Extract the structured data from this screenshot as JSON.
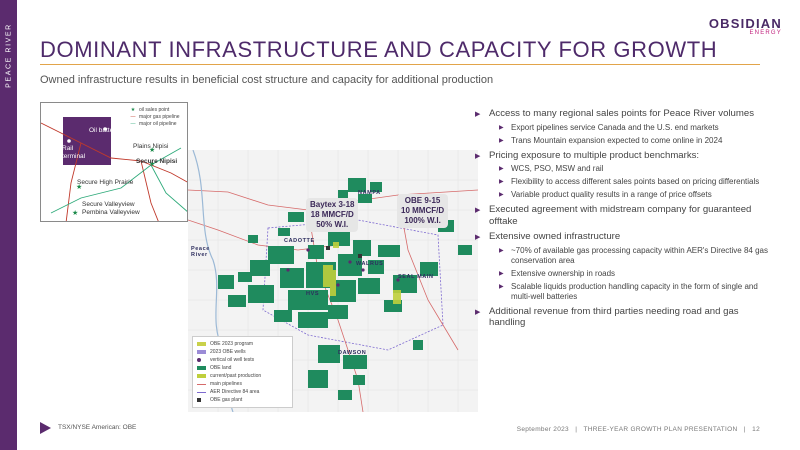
{
  "sidebar": {
    "label": "PEACE RIVER"
  },
  "logo": {
    "main": "OBSIDIAN",
    "sub": "ENERGY"
  },
  "header": {
    "title": "DOMINANT INFRASTRUCTURE AND CAPACITY FOR GROWTH",
    "subtitle": "Owned infrastructure results in beneficial cost structure and capacity for additional production"
  },
  "inset_map": {
    "labels": {
      "oil_battery": "Oil battery",
      "rail_terminal": "Rail\nterminal",
      "plains_nipisi": "Plains Nipisi",
      "secure_nipisi": "Secure Nipisi",
      "secure_high_prairie": "Secure High Prairie",
      "secure_valleyview": "Secure Valleyview",
      "pembina_valleyview": "Pembina Valleyview"
    },
    "legend": [
      {
        "marker": "★",
        "label": "oil sales point",
        "color": "#1b8a4a"
      },
      {
        "marker": "—",
        "label": "major gas pipeline",
        "color": "#c0392b"
      },
      {
        "marker": "—",
        "label": "major oil pipeline",
        "color": "#2eaa7a"
      }
    ]
  },
  "main_map": {
    "callouts": [
      {
        "text": "Baytex 3-18\n18 MMCF/D\n50% W.I."
      },
      {
        "text": "OBE 9-15\n10 MMCF/D\n100% W.I."
      }
    ],
    "towns": {
      "nampa": "NAMPA",
      "peace_river": "Peace\nRiver",
      "cadotte": "CADOTTE",
      "walrus": "WALRUS",
      "seal_main": "SEAL MAIN",
      "hvs": "HVS",
      "dawson": "DAWSON"
    },
    "legend": [
      {
        "label": "OBE 2023 program",
        "color": "#c9d14a"
      },
      {
        "label": "2023 OBE wells",
        "color": "#9b8bd6"
      },
      {
        "label": "vertical oil well tests",
        "color": "#5b2b6e"
      },
      {
        "label": "OBE land",
        "color": "#1f8b5e"
      },
      {
        "label": "current/past production",
        "color": "#bfcf3c"
      },
      {
        "label": "main pipelines",
        "color": "#d66a6a"
      },
      {
        "label": "AER Directive 84 area",
        "color": "#7e6ad0"
      },
      {
        "label": "OBE gas plant",
        "color": "#333333"
      }
    ]
  },
  "bullets": [
    {
      "text": "Access to many regional sales points for Peace River volumes",
      "sub": [
        "Export pipelines service Canada and the U.S. end markets",
        "Trans Mountain expansion expected to come online in 2024"
      ]
    },
    {
      "text": "Pricing exposure to multiple product benchmarks:",
      "sub": [
        "WCS, PSO, MSW and rail",
        "Flexibility to access different sales points based on pricing differentials",
        "Variable product quality results in a range of price offsets"
      ]
    },
    {
      "text": "Executed agreement with midstream company for guaranteed offtake",
      "sub": []
    },
    {
      "text": "Extensive owned infrastructure",
      "sub": [
        "~70% of available gas processing capacity within AER's Directive 84 gas conservation area",
        "Extensive ownership in roads",
        "Scalable liquids production handling capacity in the form of single and multi-well batteries"
      ]
    },
    {
      "text": "Additional revenue from third parties needing road and gas handling",
      "sub": []
    }
  ],
  "footer": {
    "ticker": "TSX/NYSE American: OBE",
    "date": "September 2023",
    "presentation": "THREE-YEAR GROWTH PLAN PRESENTATION",
    "page": "12",
    "separator": "|"
  },
  "colors": {
    "brand_purple": "#5b2b6e",
    "accent_orange": "#e2a44a",
    "land_green": "#1f8b5e",
    "production_yellow": "#bfcf3c"
  }
}
